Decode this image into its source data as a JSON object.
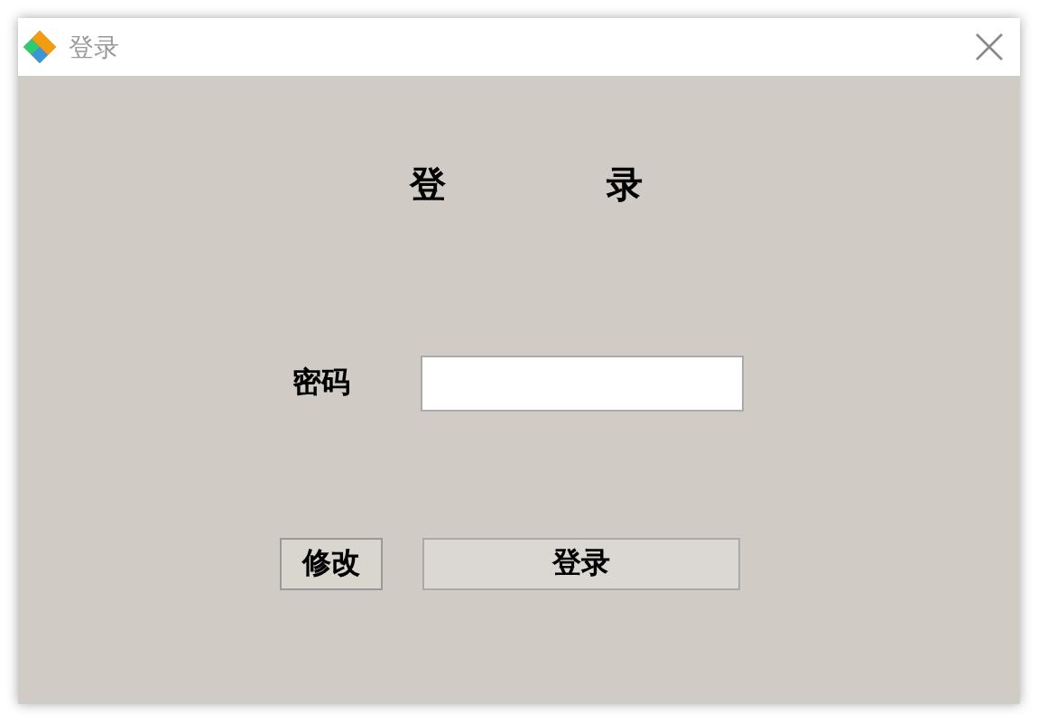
{
  "window": {
    "title": "登录"
  },
  "heading": [
    "登",
    "录"
  ],
  "password": {
    "label": "密码"
  },
  "buttons": [
    {
      "label": "修改",
      "kind": "small"
    },
    {
      "label": "登录",
      "kind": "wide"
    }
  ]
}
